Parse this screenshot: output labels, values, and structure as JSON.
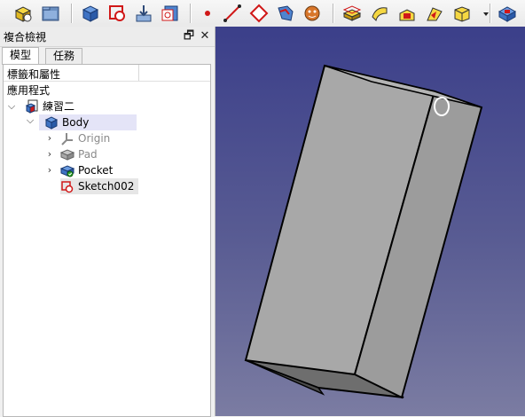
{
  "toolbar": {
    "buttons": [
      {
        "name": "part-design-icon"
      },
      {
        "name": "open-folder-icon"
      },
      {
        "name": "create-body-icon"
      },
      {
        "name": "create-sketch-icon"
      },
      {
        "name": "import-icon"
      },
      {
        "name": "validate-sketch-icon"
      },
      {
        "name": "point-icon"
      },
      {
        "name": "line-icon"
      },
      {
        "name": "plane-icon"
      },
      {
        "name": "shape-binder-icon"
      },
      {
        "name": "clone-icon"
      },
      {
        "name": "pad-icon"
      },
      {
        "name": "revolution-icon"
      },
      {
        "name": "additive-loft-icon"
      },
      {
        "name": "additive-pipe-icon"
      },
      {
        "name": "additive-primitive-icon"
      },
      {
        "name": "pocket-icon"
      }
    ]
  },
  "panel": {
    "title": "複合檢視",
    "tabs": [
      {
        "label": "模型"
      },
      {
        "label": "任務"
      }
    ],
    "tree_header": "標籤和屬性",
    "tree": {
      "root_label": "應用程式",
      "document": "練習二",
      "body": "Body",
      "children": [
        {
          "label": "Origin",
          "muted": true
        },
        {
          "label": "Pad",
          "muted": true
        },
        {
          "label": "Pocket",
          "muted": false
        },
        {
          "label": "Sketch002",
          "muted": false
        }
      ]
    }
  },
  "colors": {
    "view_top": "#3b3f8a",
    "view_bottom": "#7b7ca2",
    "body_selection": "#e4e4f7"
  }
}
